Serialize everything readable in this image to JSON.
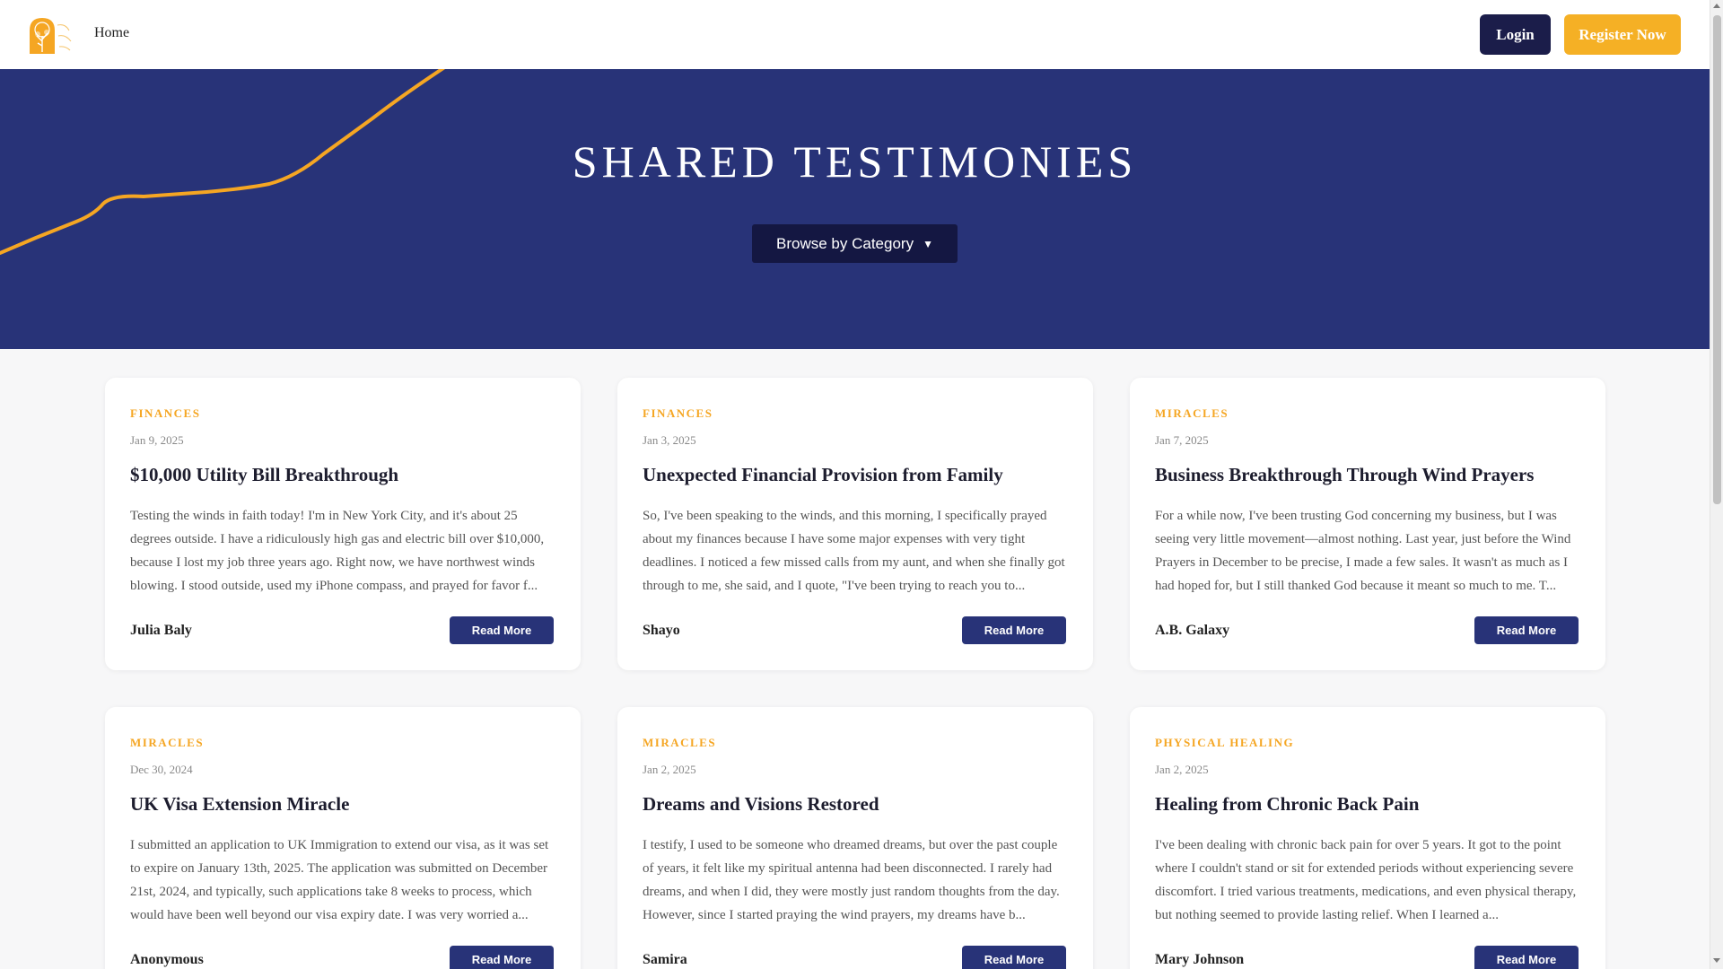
{
  "header": {
    "logo": "tree-logo",
    "nav_home": "Home",
    "login_label": "Login",
    "register_label": "Register Now"
  },
  "hero": {
    "title": "SHARED TESTIMONIES",
    "browse_label": "Browse by Category",
    "caret": "▼"
  },
  "colors": {
    "brand_navy": "#283378",
    "dark_navy": "#1b1d4a",
    "accent_orange": "#f5b025"
  },
  "cards": [
    {
      "category": "FINANCES",
      "date": "Jan 9, 2025",
      "title": "$10,000 Utility Bill Breakthrough",
      "excerpt": "Testing the winds in faith today! I'm in New York City, and it's about 25 degrees outside. I have a ridiculously high gas and electric bill over $10,000, because I lost my job three years ago. Right now, we have northwest winds blowing. I stood outside, used my iPhone compass, and prayed for favor f...",
      "author": "Julia Baly",
      "read_more": "Read More"
    },
    {
      "category": "FINANCES",
      "date": "Jan 3, 2025",
      "title": "Unexpected Financial Provision from Family",
      "excerpt": "So, I've been speaking to the winds, and this morning, I specifically prayed about my finances because I have some major expenses with very tight deadlines. I noticed a few missed calls from my aunt, and when she finally got through to me, she said, and I quote, \"I've been trying to reach you to...",
      "author": "Shayo",
      "read_more": "Read More"
    },
    {
      "category": "MIRACLES",
      "date": "Jan 7, 2025",
      "title": "Business Breakthrough Through Wind Prayers",
      "excerpt": "For a while now, I've been trusting God concerning my business, but I was seeing very little movement—almost nothing. Last year, just before the Wind Prayers in December to be precise, I made a few sales. It wasn't as much as I had hoped for, but I still thanked God because it meant so much to me. T...",
      "author": "A.B. Galaxy",
      "read_more": "Read More"
    },
    {
      "category": "MIRACLES",
      "date": "Dec 30, 2024",
      "title": "UK Visa Extension Miracle",
      "excerpt": "I submitted an application to UK Immigration to extend our visa, as it was set to expire on January 13th, 2025. The application was submitted on December 21st, 2024, and typically, such applications take 8 weeks to process, which would have been well beyond our visa expiry date. I was very worried a...",
      "author": "Anonymous",
      "read_more": "Read More"
    },
    {
      "category": "MIRACLES",
      "date": "Jan 2, 2025",
      "title": "Dreams and Visions Restored",
      "excerpt": "I testify, I used to be someone who dreamed dreams, but over the past couple of years, it felt like my spiritual antenna had been disconnected. I rarely had dreams, and when I did, they were mostly just random thoughts from the day. However, since I started praying the wind prayers, my dreams have b...",
      "author": "Samira",
      "read_more": "Read More"
    },
    {
      "category": "PHYSICAL HEALING",
      "date": "Jan 2, 2025",
      "title": "Healing from Chronic Back Pain",
      "excerpt": "I've been dealing with chronic back pain for over 5 years. It got to the point where I couldn't stand or sit for extended periods without experiencing severe discomfort. I tried various treatments, medications, and even physical therapy, but nothing seemed to provide lasting relief. When I learned a...",
      "author": "Mary Johnson",
      "read_more": "Read More"
    }
  ]
}
